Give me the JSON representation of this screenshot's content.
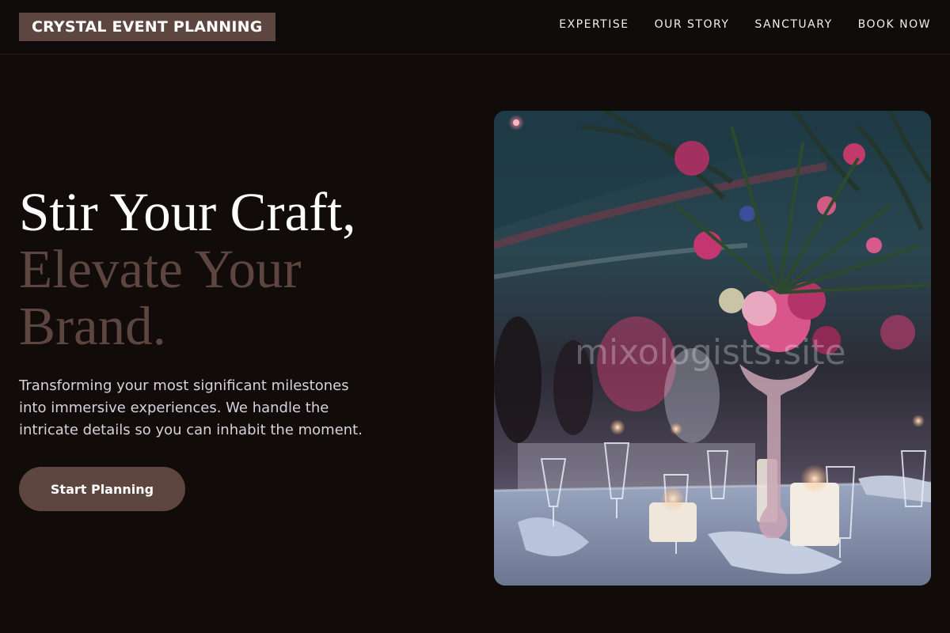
{
  "header": {
    "logo": "CRYSTAL EVENT PLANNING",
    "nav": [
      "EXPERTISE",
      "OUR STORY",
      "SANCTUARY",
      "BOOK NOW"
    ]
  },
  "hero": {
    "headline_line1": "Stir Your Craft,",
    "headline_line2": "Elevate Your",
    "headline_line3": "Brand.",
    "subtitle": "Transforming your most significant milestones into immersive experiences. We handle the intricate details so you can inhabit the moment.",
    "cta_label": "Start Planning",
    "image_icon": "event-table-photo",
    "watermark": "mixologists.site"
  },
  "colors": {
    "background": "#110b0a",
    "accent": "#5d4540",
    "text_primary": "#ffffff",
    "text_secondary": "#d6d2dc"
  }
}
